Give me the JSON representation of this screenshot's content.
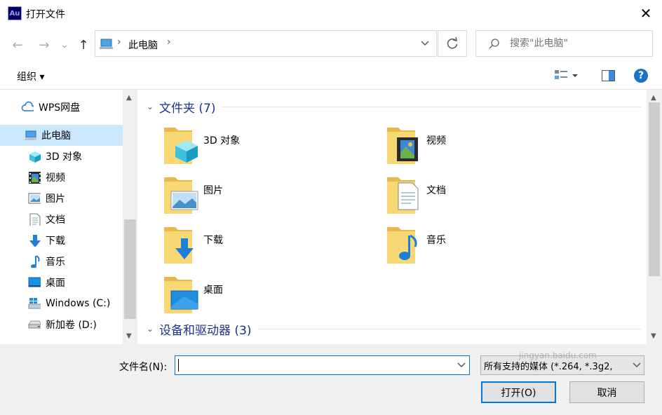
{
  "window": {
    "title": "打开文件",
    "app_icon_text": "Au",
    "close_symbol": "✕"
  },
  "nav": {
    "back": "←",
    "forward": "→",
    "recent": "⌄",
    "up": "↑"
  },
  "address": {
    "crumb": "此电脑",
    "sep": "›",
    "sep_end": "›"
  },
  "search": {
    "placeholder": "搜索\"此电脑\""
  },
  "toolbar": {
    "organize_label": "组织 ▾",
    "help_symbol": "?"
  },
  "sidebar": {
    "items": [
      {
        "label": "WPS网盘",
        "icon": "cloud-icon"
      },
      {
        "label": "此电脑",
        "icon": "computer-icon",
        "selected": true
      },
      {
        "label": "3D 对象",
        "icon": "cube-icon"
      },
      {
        "label": "视频",
        "icon": "film-icon"
      },
      {
        "label": "图片",
        "icon": "picture-icon"
      },
      {
        "label": "文档",
        "icon": "document-icon"
      },
      {
        "label": "下载",
        "icon": "download-arrow-icon"
      },
      {
        "label": "音乐",
        "icon": "music-note-icon"
      },
      {
        "label": "桌面",
        "icon": "desktop-icon"
      },
      {
        "label": "Windows (C:)",
        "icon": "windows-drive-icon"
      },
      {
        "label": "新加卷 (D:)",
        "icon": "drive-icon"
      }
    ]
  },
  "content": {
    "groups": [
      {
        "title": "文件夹 (7)"
      },
      {
        "title": "设备和驱动器 (3)"
      }
    ],
    "folders": [
      {
        "label": "3D 对象",
        "icon": "cube-icon"
      },
      {
        "label": "视频",
        "icon": "film-icon"
      },
      {
        "label": "图片",
        "icon": "picture-icon"
      },
      {
        "label": "文档",
        "icon": "document-icon"
      },
      {
        "label": "下载",
        "icon": "download-arrow-icon"
      },
      {
        "label": "音乐",
        "icon": "music-note-icon"
      },
      {
        "label": "桌面",
        "icon": "desktop-icon"
      }
    ]
  },
  "footer": {
    "filename_label": "文件名(N):",
    "filename_value": "",
    "filter_value": "所有支持的媒体 (*.264, *.3g2,",
    "open_label": "打开(O)",
    "cancel_label": "取消",
    "watermark": "jingyan.baidu.com"
  },
  "colors": {
    "accent": "#0078d7",
    "group_header": "#1e3287",
    "selection": "#cce8ff",
    "folder": "#f8d775"
  }
}
